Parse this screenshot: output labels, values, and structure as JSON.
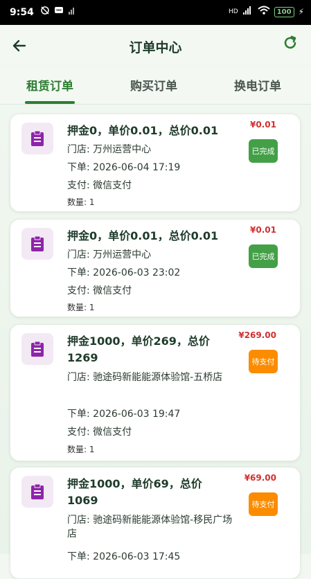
{
  "status_bar": {
    "time": "9:54",
    "battery": "100",
    "network": "HD"
  },
  "header": {
    "title": "订单中心"
  },
  "tabs": [
    {
      "label": "租赁订单",
      "active": true
    },
    {
      "label": "购买订单",
      "active": false
    },
    {
      "label": "换电订单",
      "active": false
    }
  ],
  "orders": [
    {
      "title": "押金0，单价0.01，总价0.01",
      "store": "门店: 万州运营中心",
      "time": "下单: 2026-06-04 17:19",
      "payment": "支付: 微信支付",
      "quantity": "数量: 1",
      "price": "¥0.01",
      "status": "已完成"
    },
    {
      "title": "押金0，单价0.01，总价0.01",
      "store": "门店: 万州运营中心",
      "time": "下单: 2026-06-03 23:02",
      "payment": "支付: 微信支付",
      "quantity": "数量: 1",
      "price": "¥0.01",
      "status": "已完成"
    },
    {
      "title": "押金1000，单价269，总价1269",
      "store": "门店: 驰途码新能能源体验馆-五桥店",
      "time": "下单: 2026-06-03 19:47",
      "payment": "支付: 微信支付",
      "quantity": "数量: 1",
      "price": "¥269.00",
      "status": "待支付"
    },
    {
      "title": "押金1000，单价69，总价1069",
      "store": "门店: 驰途码新能能源体验馆-移民广场店",
      "time": "下单: 2026-06-03 17:45",
      "payment": "",
      "quantity": "",
      "price": "¥69.00",
      "status": "待支付"
    }
  ],
  "colors": {
    "primary": "#2e7d32",
    "done": "#43a047",
    "pending": "#fb8c00",
    "price": "#d32f2f",
    "icon": "#8e24aa"
  }
}
